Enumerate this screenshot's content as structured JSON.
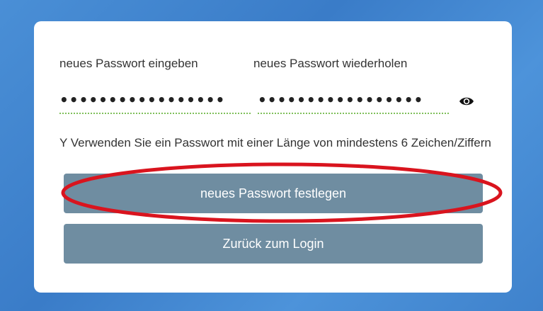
{
  "form": {
    "label_new_password": "neues Passwort eingeben",
    "label_repeat_password": "neues Passwort wiederholen",
    "new_password_masked": "•••••••••••••••••",
    "repeat_password_masked": "•••••••••••••••••",
    "hint": "Y Verwenden Sie ein Passwort mit einer Länge von mindestens 6 Zeichen/Ziffern",
    "set_password_button": "neues Passwort festlegen",
    "back_button": "Zurück zum Login"
  },
  "icons": {
    "show_password": "eye-icon"
  },
  "colors": {
    "button": "#6f8da1",
    "annotation_circle": "#d9141e",
    "field_underline": "#7fbf5a"
  }
}
